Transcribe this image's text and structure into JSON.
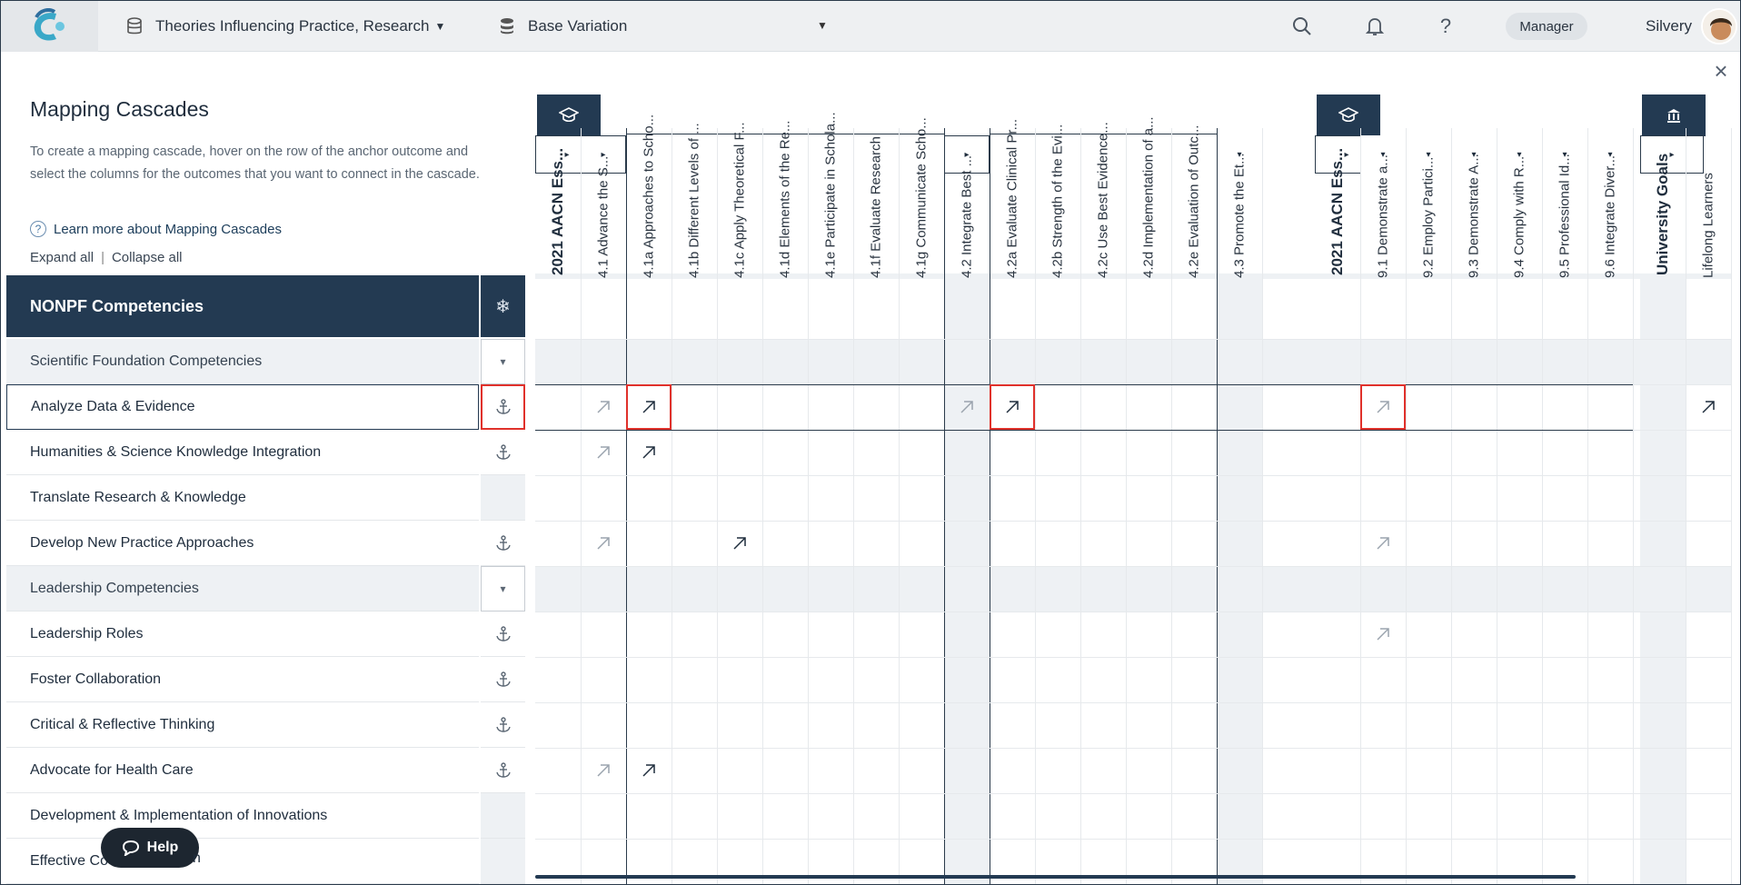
{
  "topbar": {
    "program_title": "Theories Influencing Practice, Research",
    "variation": "Base Variation",
    "role": "Manager",
    "username": "Silvery"
  },
  "panel": {
    "title": "Mapping Cascades",
    "description": "To create a mapping cascade, hover on the row of the anchor outcome and select the columns for the outcomes that you want to connect in the cascade.",
    "learn_more": "Learn more about Mapping Cascades",
    "expand_all": "Expand all",
    "separator": "|",
    "collapse_all": "Collapse all",
    "header": "NONPF Competencies",
    "rows": [
      {
        "label": "Scientific Foundation Competencies",
        "type": "group"
      },
      {
        "label": "Analyze Data & Evidence",
        "type": "item",
        "selected": true,
        "anchor": true
      },
      {
        "label": "Humanities & Science Knowledge Integration",
        "type": "item",
        "anchor": true
      },
      {
        "label": "Translate Research & Knowledge",
        "type": "item",
        "anchor": false
      },
      {
        "label": "Develop New Practice Approaches",
        "type": "item",
        "anchor": true
      },
      {
        "label": "Leadership Competencies",
        "type": "group"
      },
      {
        "label": "Leadership Roles",
        "type": "item",
        "anchor": true
      },
      {
        "label": "Foster Collaboration",
        "type": "item",
        "anchor": true
      },
      {
        "label": "Critical & Reflective Thinking",
        "type": "item",
        "anchor": true
      },
      {
        "label": "Advocate for Health Care",
        "type": "item",
        "anchor": true
      },
      {
        "label": "Development & Implementation of Innovations",
        "type": "item",
        "anchor": false
      },
      {
        "label": "Effective Co",
        "type": "item",
        "anchor": false
      }
    ],
    "help_label": "Help",
    "partial_tail": "n"
  },
  "grid": {
    "columns": [
      {
        "label": "2021 AACN Ess...",
        "big": true
      },
      {
        "label": "4.1 Advance the S..."
      },
      {
        "label": "4.1a Approaches to Scho..."
      },
      {
        "label": "4.1b Different Levels of ..."
      },
      {
        "label": "4.1c Apply Theoretical F..."
      },
      {
        "label": "4.1d Elements of the Re..."
      },
      {
        "label": "4.1e Participate in Schola..."
      },
      {
        "label": "4.1f Evaluate Research"
      },
      {
        "label": "4.1g Communicate Scho..."
      },
      {
        "label": "4.2 Integrate Best ..."
      },
      {
        "label": "4.2a Evaluate Clinical Pr..."
      },
      {
        "label": "4.2b Strength of the Evi..."
      },
      {
        "label": "4.2c Use Best Evidence..."
      },
      {
        "label": "4.2d Implementation of a..."
      },
      {
        "label": "4.2e Evaluation of Outc..."
      },
      {
        "label": "4.3 Promote the Et..."
      },
      {
        "label": "2021 AACN Ess...",
        "big": true
      },
      {
        "label": "9.1 Demonstrate a..."
      },
      {
        "label": "9.2 Employ Partici..."
      },
      {
        "label": "9.3 Demonstrate A..."
      },
      {
        "label": "9.4 Comply with R..."
      },
      {
        "label": "9.5 Professional Id..."
      },
      {
        "label": "9.6 Integrate Diver..."
      },
      {
        "label": "University Goals",
        "big": true
      },
      {
        "label": "Lifelong Learners"
      }
    ],
    "toggle_right": "▸",
    "toggle_down": "▾",
    "icons": {
      "group_tab_1": "graduation-cap-icon",
      "group_tab_2": "graduation-cap-icon",
      "group_tab_3": "institution-icon",
      "anchor": "anchor-icon",
      "freeze": "snowflake-icon",
      "mapping": "arrow-up-right-icon"
    }
  }
}
